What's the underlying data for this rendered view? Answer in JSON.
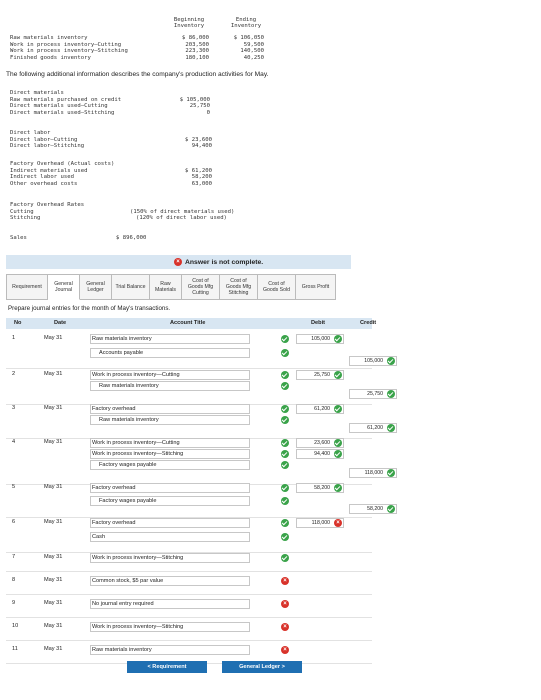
{
  "inventory_table": {
    "col_beginning": "Beginning\nInventory",
    "col_ending": "Ending\nInventory",
    "rows": [
      {
        "label": "Raw materials inventory",
        "beginning": "$ 86,000",
        "ending": "$ 106,050"
      },
      {
        "label": "Work in process inventory—Cutting",
        "beginning": "203,500",
        "ending": "59,500"
      },
      {
        "label": "Work in process inventory—Stitching",
        "beginning": "223,300",
        "ending": "140,500"
      },
      {
        "label": "Finished goods inventory",
        "beginning": "180,100",
        "ending": "40,250"
      }
    ]
  },
  "description": "The following additional information describes the company's production activities for May.",
  "activities": {
    "direct_materials": {
      "heading": "Direct materials",
      "lines": [
        {
          "label": "Raw materials purchased on credit",
          "value": "$ 105,000"
        },
        {
          "label": "Direct materials used—Cutting",
          "value": "25,750"
        },
        {
          "label": "Direct materials used—Stitching",
          "value": "0"
        }
      ]
    },
    "direct_labor": {
      "heading": "Direct labor",
      "lines": [
        {
          "label": "Direct labor—Cutting",
          "value": "$ 23,600"
        },
        {
          "label": "Direct labor—Stitching",
          "value": "94,400"
        }
      ]
    },
    "factory_overhead": {
      "heading": "Factory Overhead (Actual costs)",
      "lines": [
        {
          "label": "Indirect materials used",
          "value": "$ 61,200"
        },
        {
          "label": "Indirect labor used",
          "value": "58,200"
        },
        {
          "label": "Other overhead costs",
          "value": "63,000"
        }
      ]
    },
    "overhead_rates": {
      "heading": "Factory Overhead Rates",
      "lines": [
        {
          "label": "Cutting",
          "value": "(150% of direct materials used)"
        },
        {
          "label": "Stitching",
          "value": "(120% of direct labor used)"
        }
      ]
    },
    "sales": {
      "label": "Sales",
      "value": "$ 896,000"
    }
  },
  "banner": {
    "text": "Answer is not complete."
  },
  "tabs": [
    {
      "label": "Requirement"
    },
    {
      "label": "General\nJournal"
    },
    {
      "label": "General\nLedger"
    },
    {
      "label": "Trial Balance"
    },
    {
      "label": "Raw\nMaterials"
    },
    {
      "label": "Cost of\nGoods Mfg\nCutting"
    },
    {
      "label": "Cost of\nGoods Mfg\nStitching"
    },
    {
      "label": "Cost of\nGoods Sold"
    },
    {
      "label": "Gross Profit"
    }
  ],
  "instruction": "Prepare journal entries for the month of May's transactions.",
  "journal": {
    "headers": {
      "no": "No",
      "date": "Date",
      "account": "Account Title",
      "debit": "Debit",
      "credit": "Credit"
    },
    "entries": [
      {
        "no": "1",
        "date": "May 31",
        "lines": [
          {
            "account": "Raw materials inventory",
            "debit": "105,000",
            "credit": "",
            "status": "ok"
          },
          {
            "account": "Accounts payable",
            "debit": "",
            "credit": "105,000",
            "status": "ok"
          }
        ]
      },
      {
        "no": "2",
        "date": "May 31",
        "lines": [
          {
            "account": "Work in process inventory—Cutting",
            "debit": "25,750",
            "credit": "",
            "status": "ok"
          },
          {
            "account": "Raw materials inventory",
            "debit": "",
            "credit": "25,750",
            "status": "ok"
          }
        ]
      },
      {
        "no": "3",
        "date": "May 31",
        "lines": [
          {
            "account": "Factory overhead",
            "debit": "61,200",
            "credit": "",
            "status": "ok"
          },
          {
            "account": "Raw materials inventory",
            "debit": "",
            "credit": "61,200",
            "status": "ok"
          }
        ]
      },
      {
        "no": "4",
        "date": "May 31",
        "lines": [
          {
            "account": "Work in process inventory—Cutting",
            "debit": "23,600",
            "credit": "",
            "status": "ok"
          },
          {
            "account": "Work in process inventory—Stitching",
            "debit": "94,400",
            "credit": "",
            "status": "ok"
          },
          {
            "account": "Factory wages payable",
            "debit": "",
            "credit": "118,000",
            "status": "ok"
          }
        ]
      },
      {
        "no": "5",
        "date": "May 31",
        "lines": [
          {
            "account": "Factory overhead",
            "debit": "58,200",
            "credit": "",
            "status": "ok"
          },
          {
            "account": "Factory wages payable",
            "debit": "",
            "credit": "58,200",
            "status": "ok"
          }
        ]
      },
      {
        "no": "6",
        "date": "May 31",
        "lines": [
          {
            "account": "Factory overhead",
            "debit": "118,000",
            "credit": "",
            "status": "ok",
            "debit_status": "error"
          },
          {
            "account": "Cash",
            "debit": "",
            "credit": "",
            "status": "ok"
          }
        ]
      },
      {
        "no": "7",
        "date": "May 31",
        "lines": [
          {
            "account": "Work in process inventory—Stitching",
            "debit": "",
            "credit": "",
            "status": "ok"
          }
        ]
      },
      {
        "no": "8",
        "date": "May 31",
        "lines": [
          {
            "account": "Common stock, $5 par value",
            "debit": "",
            "credit": "",
            "status": "error"
          }
        ]
      },
      {
        "no": "9",
        "date": "May 31",
        "lines": [
          {
            "account": "No journal entry required",
            "debit": "",
            "credit": "",
            "status": "error"
          }
        ]
      },
      {
        "no": "10",
        "date": "May 31",
        "lines": [
          {
            "account": "Work in process inventory—Stitching",
            "debit": "",
            "credit": "",
            "status": "error"
          }
        ]
      },
      {
        "no": "11",
        "date": "May 31",
        "lines": [
          {
            "account": "Raw materials inventory",
            "debit": "",
            "credit": "",
            "status": "error"
          }
        ]
      }
    ]
  },
  "nav": {
    "prev": "< Requirement",
    "next": "General Ledger >"
  },
  "colors": {
    "accent": "#1f6fb2",
    "ok": "#3aa34a",
    "error": "#d8322a",
    "header_bg": "#d8e6f2"
  }
}
